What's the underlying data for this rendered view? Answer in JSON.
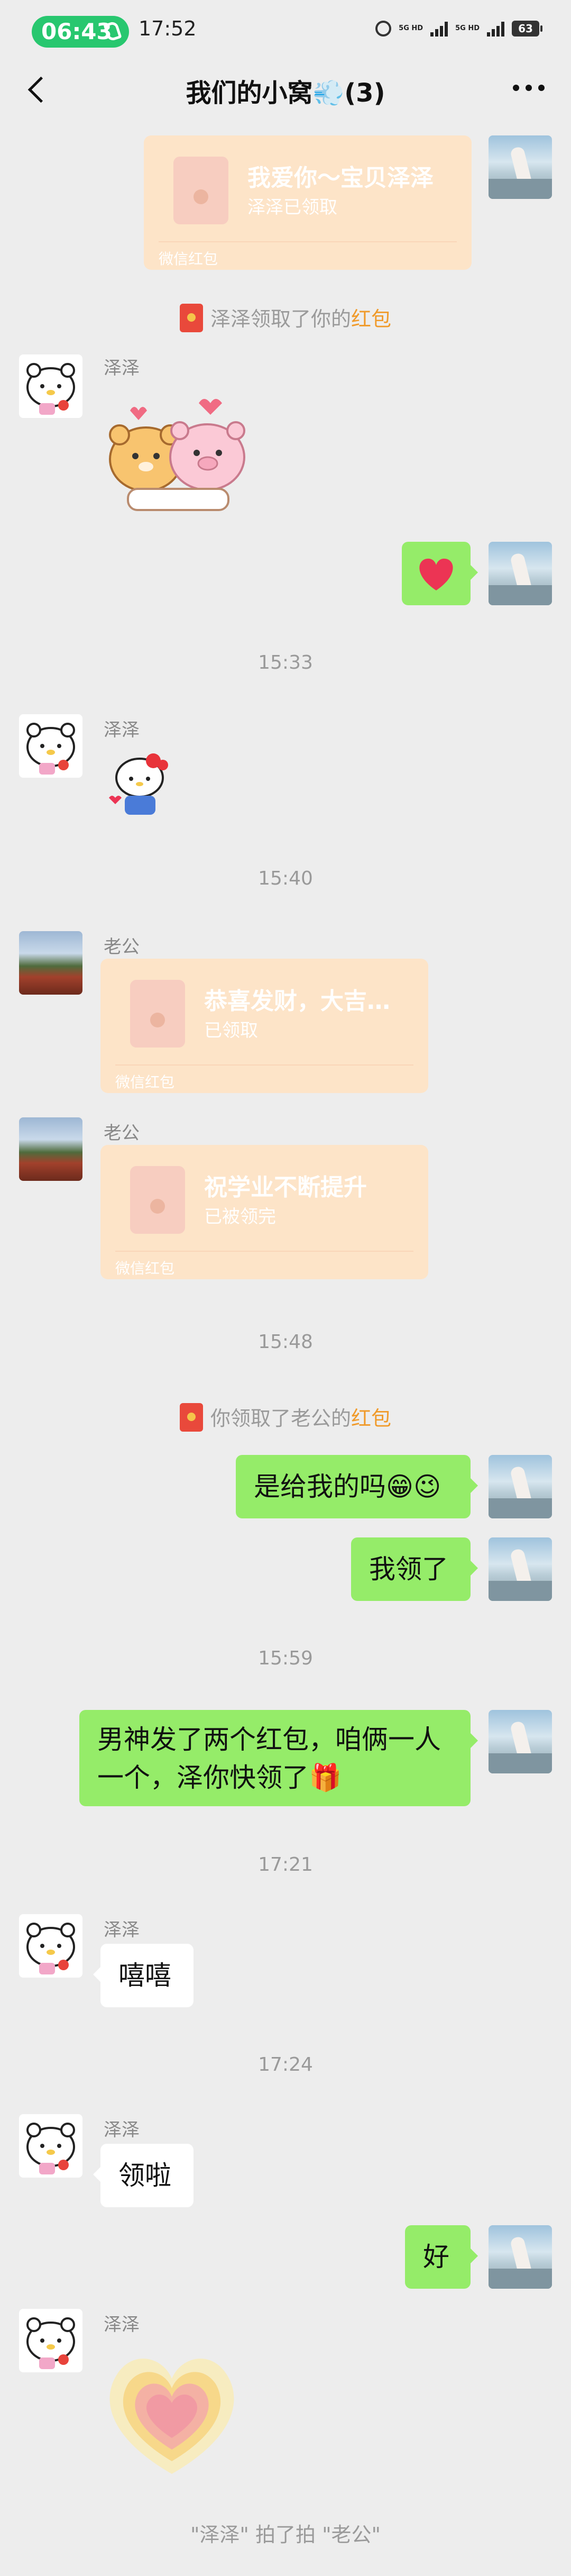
{
  "status": {
    "time_pill": "06:43",
    "clock": "17:52",
    "net1": "5G HD",
    "net2": "5G HD",
    "battery": "63"
  },
  "header": {
    "title": "我们的小窝💨(3)"
  },
  "messages": {
    "m1": {
      "title": "我爱你～宝贝泽泽",
      "sub": "泽泽已领取",
      "foot": "微信红包"
    },
    "s1": {
      "pre": "泽泽领取了你的",
      "hl": "红包"
    },
    "m2_name": "泽泽",
    "m4_name": "泽泽",
    "t1": "15:33",
    "t2": "15:40",
    "m5": {
      "name": "老公",
      "title": "恭喜发财，大吉…",
      "sub": "已领取",
      "foot": "微信红包"
    },
    "m6": {
      "name": "老公",
      "title": "祝学业不断提升",
      "sub": "已被领完",
      "foot": "微信红包"
    },
    "t3": "15:48",
    "s2": {
      "pre": "你领取了老公的",
      "hl": "红包"
    },
    "m7": "是给我的吗😁😉",
    "m8": "我领了",
    "t4": "15:59",
    "m9": "男神发了两个红包，咱俩一人一个，泽你快领了🎁",
    "t5": "17:21",
    "m10": {
      "name": "泽泽",
      "text": "嘻嘻"
    },
    "t6": "17:24",
    "m11": {
      "name": "泽泽",
      "text": "领啦"
    },
    "m12": "好",
    "m13_name": "泽泽",
    "pat": "\"泽泽\" 拍了拍 \"老公\""
  }
}
